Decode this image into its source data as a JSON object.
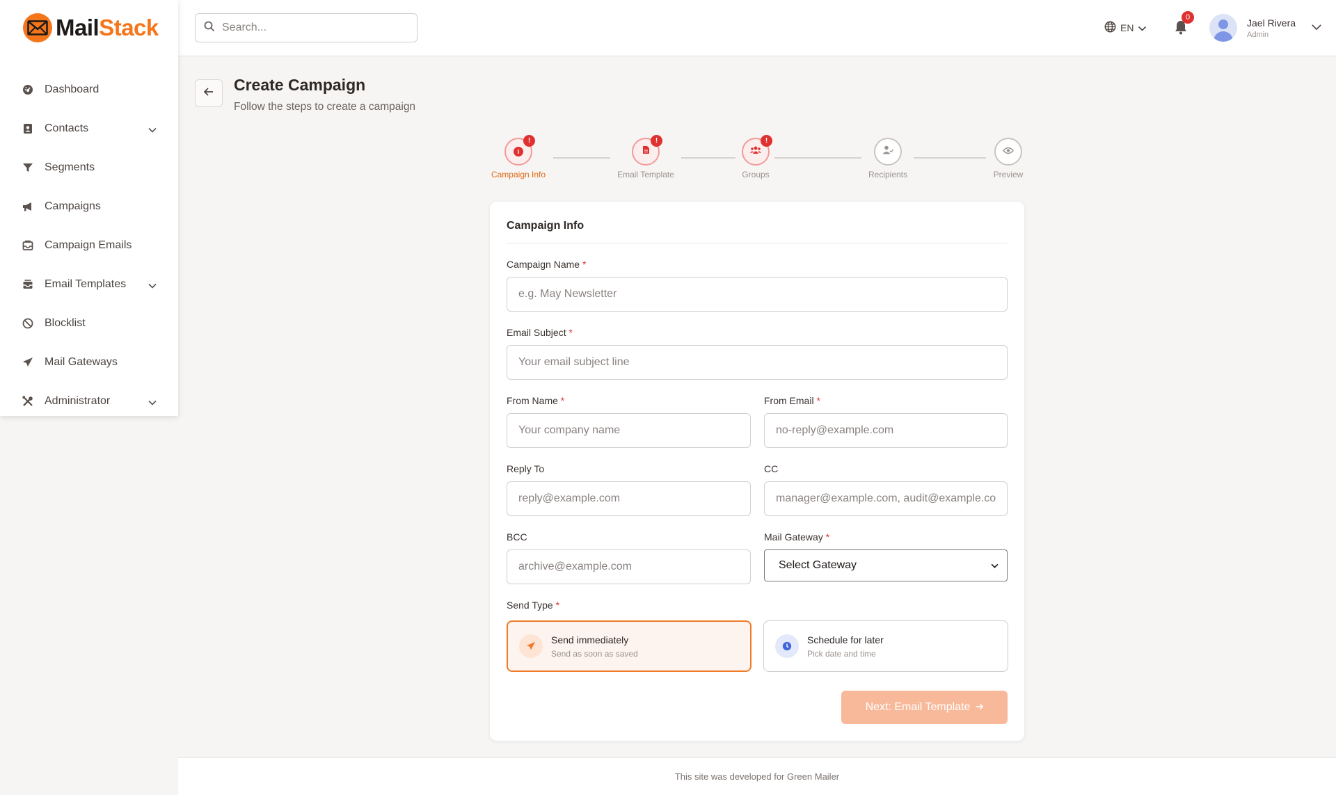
{
  "brand": {
    "name_part1": "Mail",
    "name_part2": "Stack",
    "accent": "#f5761a"
  },
  "sidebar": {
    "items": [
      {
        "label": "Dashboard",
        "icon": "dashboard-icon",
        "has_submenu": false
      },
      {
        "label": "Contacts",
        "icon": "contacts-icon",
        "has_submenu": true
      },
      {
        "label": "Segments",
        "icon": "filter-icon",
        "has_submenu": false
      },
      {
        "label": "Campaigns",
        "icon": "megaphone-icon",
        "has_submenu": false
      },
      {
        "label": "Campaign Emails",
        "icon": "inbox-icon",
        "has_submenu": false
      },
      {
        "label": "Email Templates",
        "icon": "template-icon",
        "has_submenu": true
      },
      {
        "label": "Blocklist",
        "icon": "block-icon",
        "has_submenu": false
      },
      {
        "label": "Mail Gateways",
        "icon": "paper-plane-icon",
        "has_submenu": false
      },
      {
        "label": "Administrator",
        "icon": "tools-icon",
        "has_submenu": true
      }
    ]
  },
  "header": {
    "search_placeholder": "Search...",
    "language": "EN",
    "notification_count": "0",
    "user": {
      "name": "Jael Rivera",
      "role": "Admin"
    }
  },
  "page": {
    "title": "Create Campaign",
    "subtitle": "Follow the steps to create a campaign"
  },
  "stepper": {
    "steps": [
      {
        "label": "Campaign Info",
        "state": "error-active",
        "icon": "info-icon"
      },
      {
        "label": "Email Template",
        "state": "error",
        "icon": "file-icon"
      },
      {
        "label": "Groups",
        "state": "error",
        "icon": "users-icon"
      },
      {
        "label": "Recipients",
        "state": "pending",
        "icon": "user-check-icon"
      },
      {
        "label": "Preview",
        "state": "pending",
        "icon": "eye-icon"
      }
    ],
    "alert_mark": "!"
  },
  "form": {
    "section_title": "Campaign Info",
    "required_mark": "*",
    "campaign_name": {
      "label": "Campaign Name",
      "placeholder": "e.g. May Newsletter",
      "value": ""
    },
    "email_subject": {
      "label": "Email Subject",
      "placeholder": "Your email subject line",
      "value": ""
    },
    "from_name": {
      "label": "From Name",
      "placeholder": "Your company name",
      "value": ""
    },
    "from_email": {
      "label": "From Email",
      "placeholder": "no-reply@example.com",
      "value": ""
    },
    "reply_to": {
      "label": "Reply To",
      "placeholder": "reply@example.com",
      "value": ""
    },
    "cc": {
      "label": "CC",
      "placeholder": "manager@example.com, audit@example.com",
      "value": ""
    },
    "bcc": {
      "label": "BCC",
      "placeholder": "archive@example.com",
      "value": ""
    },
    "mail_gateway": {
      "label": "Mail Gateway",
      "selected": "Select Gateway"
    },
    "send_type": {
      "label": "Send Type",
      "options": [
        {
          "title": "Send immediately",
          "description": "Send as soon as saved",
          "selected": true
        },
        {
          "title": "Schedule for later",
          "description": "Pick date and time",
          "selected": false
        }
      ]
    },
    "next_button": "Next: Email Template"
  },
  "footer": {
    "text": "This site was developed for Green Mailer"
  }
}
